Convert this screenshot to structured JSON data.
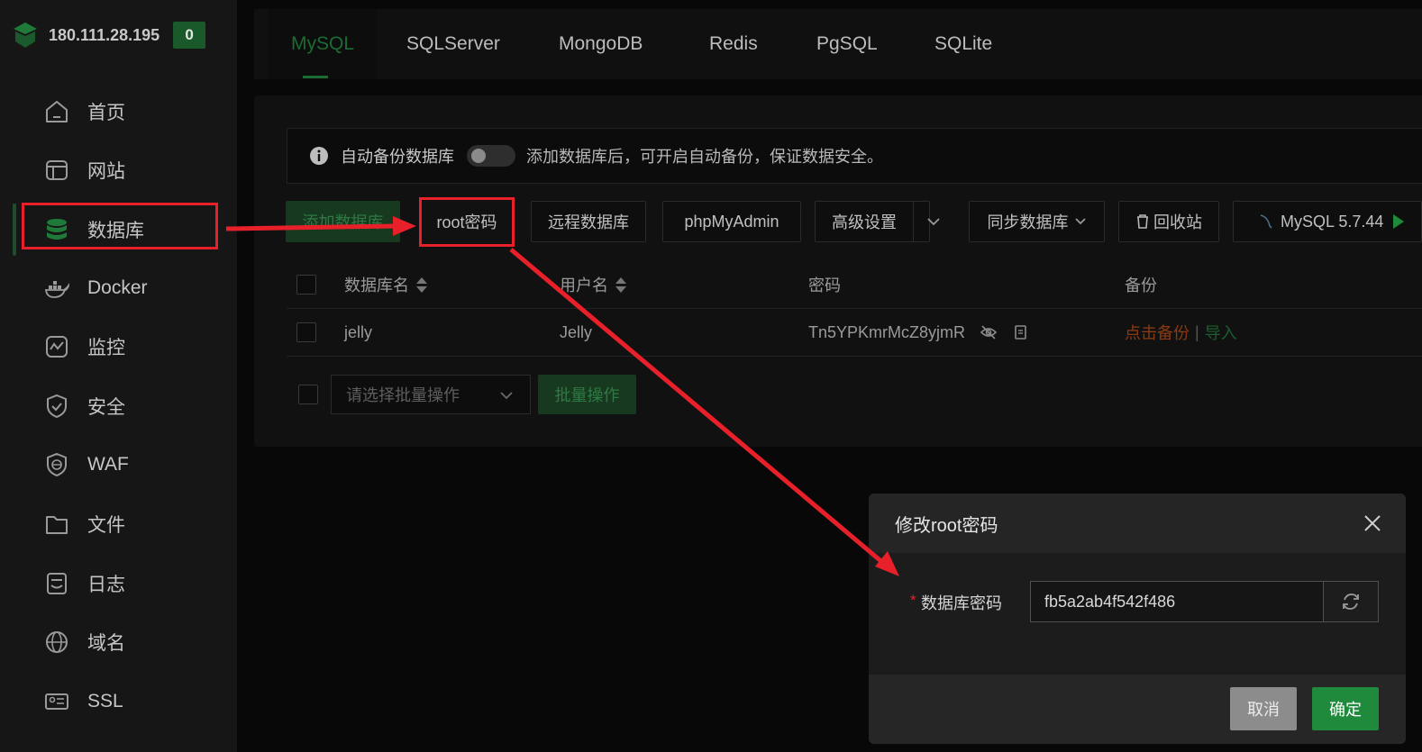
{
  "server": {
    "ip": "180.111.28.195",
    "badge_count": "0"
  },
  "sidebar": {
    "items": [
      {
        "label": "首页",
        "icon": "home-icon"
      },
      {
        "label": "网站",
        "icon": "website-icon"
      },
      {
        "label": "数据库",
        "icon": "database-icon"
      },
      {
        "label": "Docker",
        "icon": "docker-icon"
      },
      {
        "label": "监控",
        "icon": "monitor-icon"
      },
      {
        "label": "安全",
        "icon": "shield-icon"
      },
      {
        "label": "WAF",
        "icon": "waf-icon"
      },
      {
        "label": "文件",
        "icon": "folder-icon"
      },
      {
        "label": "日志",
        "icon": "log-icon"
      },
      {
        "label": "域名",
        "icon": "globe-icon"
      },
      {
        "label": "SSL",
        "icon": "ssl-icon"
      }
    ],
    "active": "数据库"
  },
  "tabs": [
    "MySQL",
    "SQLServer",
    "MongoDB",
    "Redis",
    "PgSQL",
    "SQLite"
  ],
  "notice": {
    "label": "自动备份数据库",
    "tip": "添加数据库后，可开启自动备份，保证数据安全。"
  },
  "toolbar": {
    "add_db": "添加数据库",
    "root_password": "root密码",
    "remote_db": "远程数据库",
    "phpmyadmin": "phpMyAdmin",
    "advanced": "高级设置",
    "sync_db": "同步数据库",
    "recycle": "回收站",
    "mysql_version": "MySQL 5.7.44"
  },
  "table": {
    "headers": {
      "db_name": "数据库名",
      "username": "用户名",
      "password": "密码",
      "backup": "备份"
    },
    "rows": [
      {
        "db_name": "jelly",
        "username": "Jelly",
        "password": "Tn5YPKmrMcZ8yjmR",
        "backup_action": "点击备份",
        "import_action": "导入"
      }
    ]
  },
  "batch": {
    "placeholder": "请选择批量操作",
    "button": "批量操作"
  },
  "dialog": {
    "title": "修改root密码",
    "field_required": "*",
    "field_label": "数据库密码",
    "field_value": "fb5a2ab4f542f486",
    "cancel": "取消",
    "confirm": "确定"
  },
  "colors": {
    "accent_green": "#1f8a3b",
    "annotation_red": "#e8202a"
  }
}
